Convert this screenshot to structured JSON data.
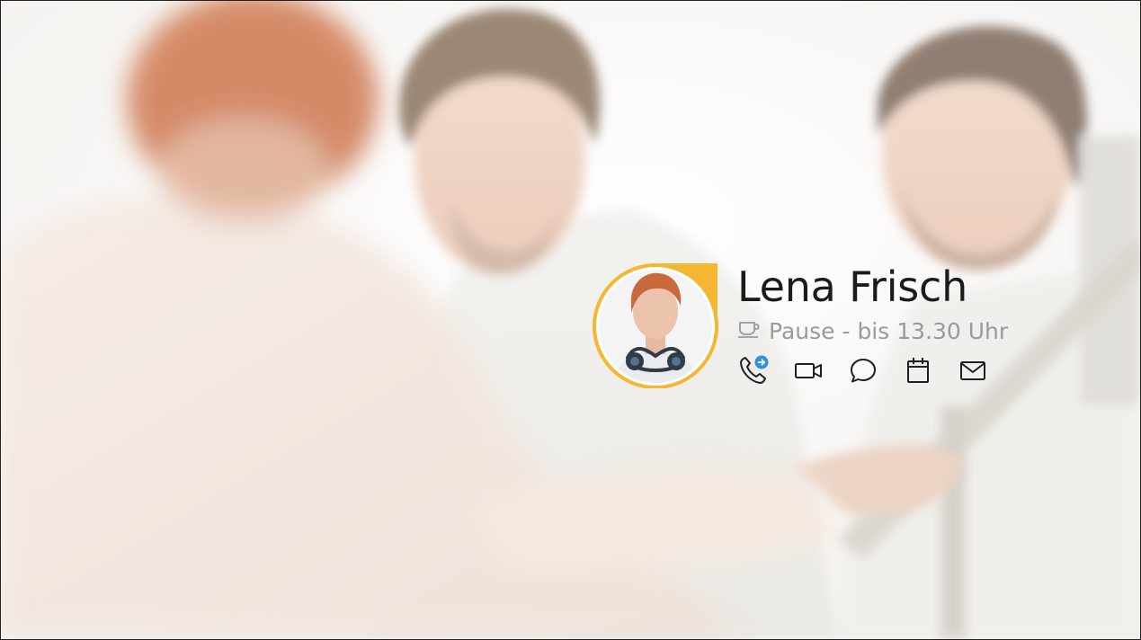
{
  "contact": {
    "name": "Lena Frisch",
    "status_text": "Pause - bis 13.30 Uhr",
    "status_icon": "coffee-cup-icon",
    "presence_color": "#f5b731"
  },
  "actions": [
    {
      "icon": "phone-forward-icon"
    },
    {
      "icon": "video-icon"
    },
    {
      "icon": "chat-icon"
    },
    {
      "icon": "calendar-icon"
    },
    {
      "icon": "mail-icon"
    }
  ],
  "colors": {
    "accent_blue": "#2f8fe0",
    "presence_yellow": "#f5b731",
    "name_text": "#1b1b1b",
    "status_text": "#9a9a9a"
  }
}
